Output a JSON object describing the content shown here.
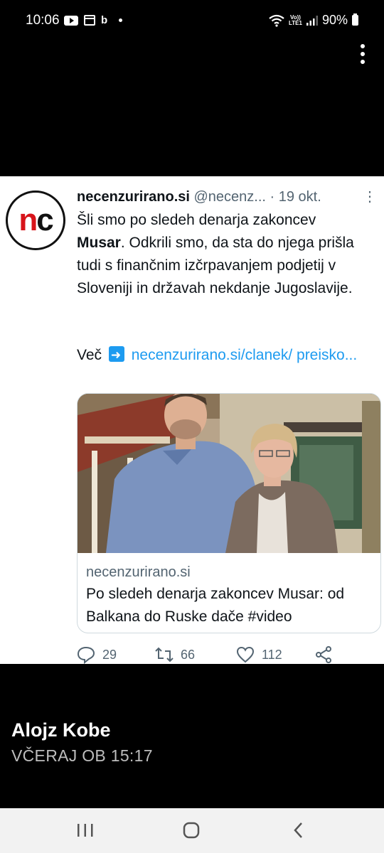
{
  "status_bar": {
    "time": "10:06",
    "notif_letter": "b",
    "network_top": "Vo))",
    "network_bottom": "LTE1",
    "battery": "90%"
  },
  "tweet": {
    "author_name": "necenzurirano.si",
    "handle_date": "@necenz... · 19 okt.",
    "menu": "⋮",
    "avatar_n": "n",
    "avatar_c": "c",
    "body_lead": "Šli smo po sledeh denarja zakoncev",
    "body_bold": "Musar",
    "body_rest": ". Odkrili smo, da sta do njega prišla tudi s finančnim izčrpavanjem podjetij v Sloveniji in državah nekdanje Jugoslavije.",
    "more_label": "Več",
    "link_text": "necenzurirano.si/clanek/ preisko...",
    "card": {
      "domain": "necenzurirano.si",
      "title": "Po sledeh denarja zakoncev Musar: od Balkana do Ruske dače #video"
    },
    "actions": {
      "replies": "29",
      "retweets": "66",
      "likes": "112"
    }
  },
  "comment": {
    "author": "Alojz Kobe",
    "time": "VČERAJ OB 15:17"
  },
  "colors": {
    "link": "#1d9bf0",
    "brand_red": "#d7141a"
  }
}
